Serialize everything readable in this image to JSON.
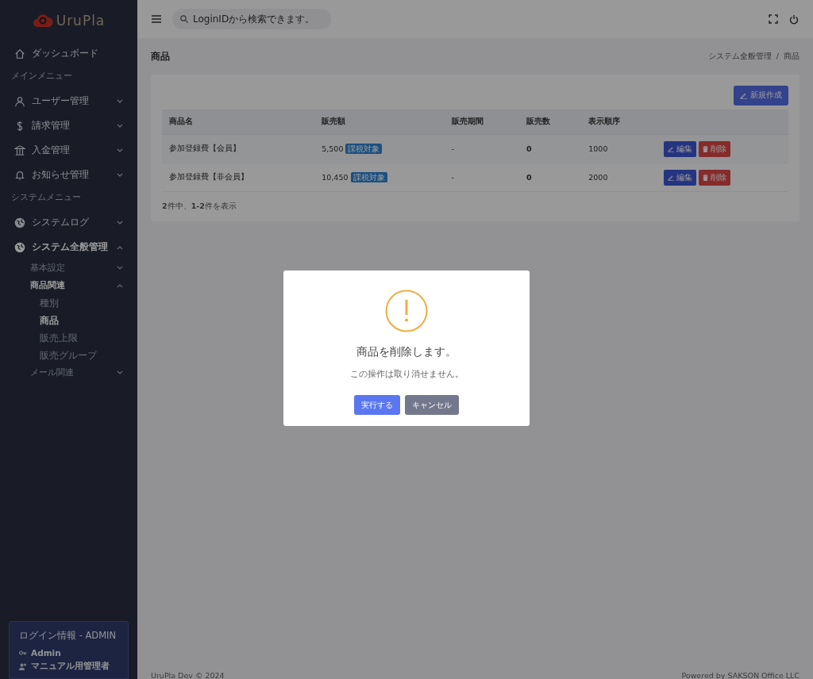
{
  "sidebar": {
    "logo": "UruPla",
    "nav": [
      {
        "kind": "link",
        "label": "ダッシュボード"
      },
      {
        "kind": "heading",
        "label": "メインメニュー"
      },
      {
        "kind": "menu",
        "label": "ユーザー管理",
        "expanded": false
      },
      {
        "kind": "menu",
        "label": "請求管理",
        "expanded": false
      },
      {
        "kind": "menu",
        "label": "入金管理",
        "expanded": false
      },
      {
        "kind": "menu",
        "label": "お知らせ管理",
        "expanded": false
      },
      {
        "kind": "heading",
        "label": "システムメニュー"
      },
      {
        "kind": "menu",
        "label": "システムログ",
        "expanded": false
      },
      {
        "kind": "menu",
        "label": "システム全般管理",
        "expanded": true,
        "children": [
          {
            "label": "基本設定",
            "expanded": false
          },
          {
            "label": "商品関連",
            "expanded": true,
            "children": [
              {
                "label": "種別",
                "selected": false
              },
              {
                "label": "商品",
                "selected": true
              },
              {
                "label": "販売上限",
                "selected": false
              },
              {
                "label": "販売グループ",
                "selected": false
              }
            ]
          },
          {
            "label": "メール関連",
            "expanded": false
          }
        ]
      }
    ],
    "login": {
      "title": "ログイン情報 - ADMIN",
      "user": "Admin",
      "role": "マニュアル用管理者"
    }
  },
  "topbar": {
    "search": {
      "placeholder": "LoginIDから検索できます。"
    }
  },
  "page": {
    "title": "商品",
    "breadcrumb": [
      "システム全般管理",
      "商品"
    ],
    "breadcrumb_separator": "/"
  },
  "card": {
    "new_button": "新規作成",
    "table": {
      "columns": [
        "商品名",
        "販売額",
        "販売期間",
        "販売数",
        "表示順序"
      ],
      "rows": [
        {
          "name": "参加登録費【会員】",
          "price": "5,500",
          "tax_badge": "課税対象",
          "period": "-",
          "sold": "0",
          "order": "1000",
          "edit": "編集",
          "delete": "削除"
        },
        {
          "name": "参加登録費【非会員】",
          "price": "10,450",
          "tax_badge": "課税対象",
          "period": "-",
          "sold": "0",
          "order": "2000",
          "edit": "編集",
          "delete": "削除"
        }
      ]
    },
    "summary": "**2**件中、**1-2**件を表示"
  },
  "footer": {
    "left": "UruPla Dev © 2024",
    "right": "Powered by SAKSON Office LLC"
  },
  "modal": {
    "title": "商品を削除します。",
    "message": "この操作は取り消せません。",
    "confirm": "実行する",
    "cancel": "キャンセル"
  }
}
